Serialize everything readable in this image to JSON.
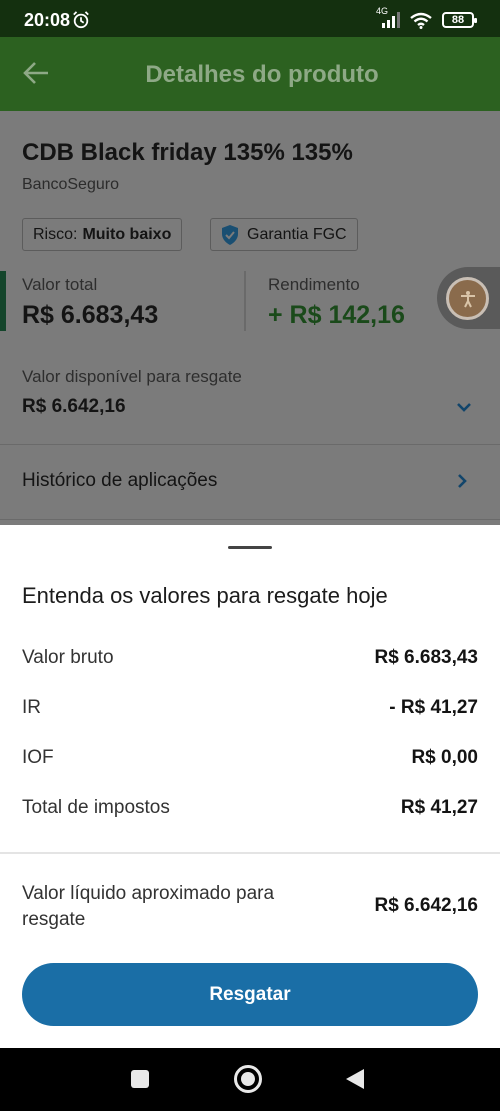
{
  "status_bar": {
    "time": "20:08",
    "network": "4G",
    "battery": "88"
  },
  "header": {
    "title": "Detalhes do produto"
  },
  "product": {
    "name": "CDB Black friday 135% 135%",
    "issuer": "BancoSeguro",
    "risk_label": "Risco:",
    "risk_value": "Muito baixo",
    "guarantee": "Garantia FGC",
    "total_label": "Valor total",
    "total_value": "R$ 6.683,43",
    "yield_label": "Rendimento",
    "yield_value": "+ R$ 142,16",
    "available_label": "Valor disponível para resgate",
    "available_value": "R$ 6.642,16",
    "history_label": "Histórico de aplicações"
  },
  "sheet": {
    "title": "Entenda os valores para resgate hoje",
    "rows": [
      {
        "label": "Valor bruto",
        "value": "R$ 6.683,43"
      },
      {
        "label": "IR",
        "value": "- R$ 41,27"
      },
      {
        "label": "IOF",
        "value": "R$ 0,00"
      },
      {
        "label": "Total de impostos",
        "value": "R$ 41,27"
      }
    ],
    "net_label": "Valor líquido aproximado para resgate",
    "net_value": "R$ 6.642,16",
    "button_label": "Resgatar"
  },
  "colors": {
    "header": "#2c6120",
    "primary_button": "#1a6ea6",
    "yield": "#1a4a1a"
  },
  "icons": [
    "alarm-icon",
    "signal-icon",
    "wifi-icon",
    "battery-icon",
    "back-arrow-icon",
    "shield-check-icon",
    "chevron-down-icon",
    "chevron-right-icon",
    "accessibility-icon"
  ]
}
